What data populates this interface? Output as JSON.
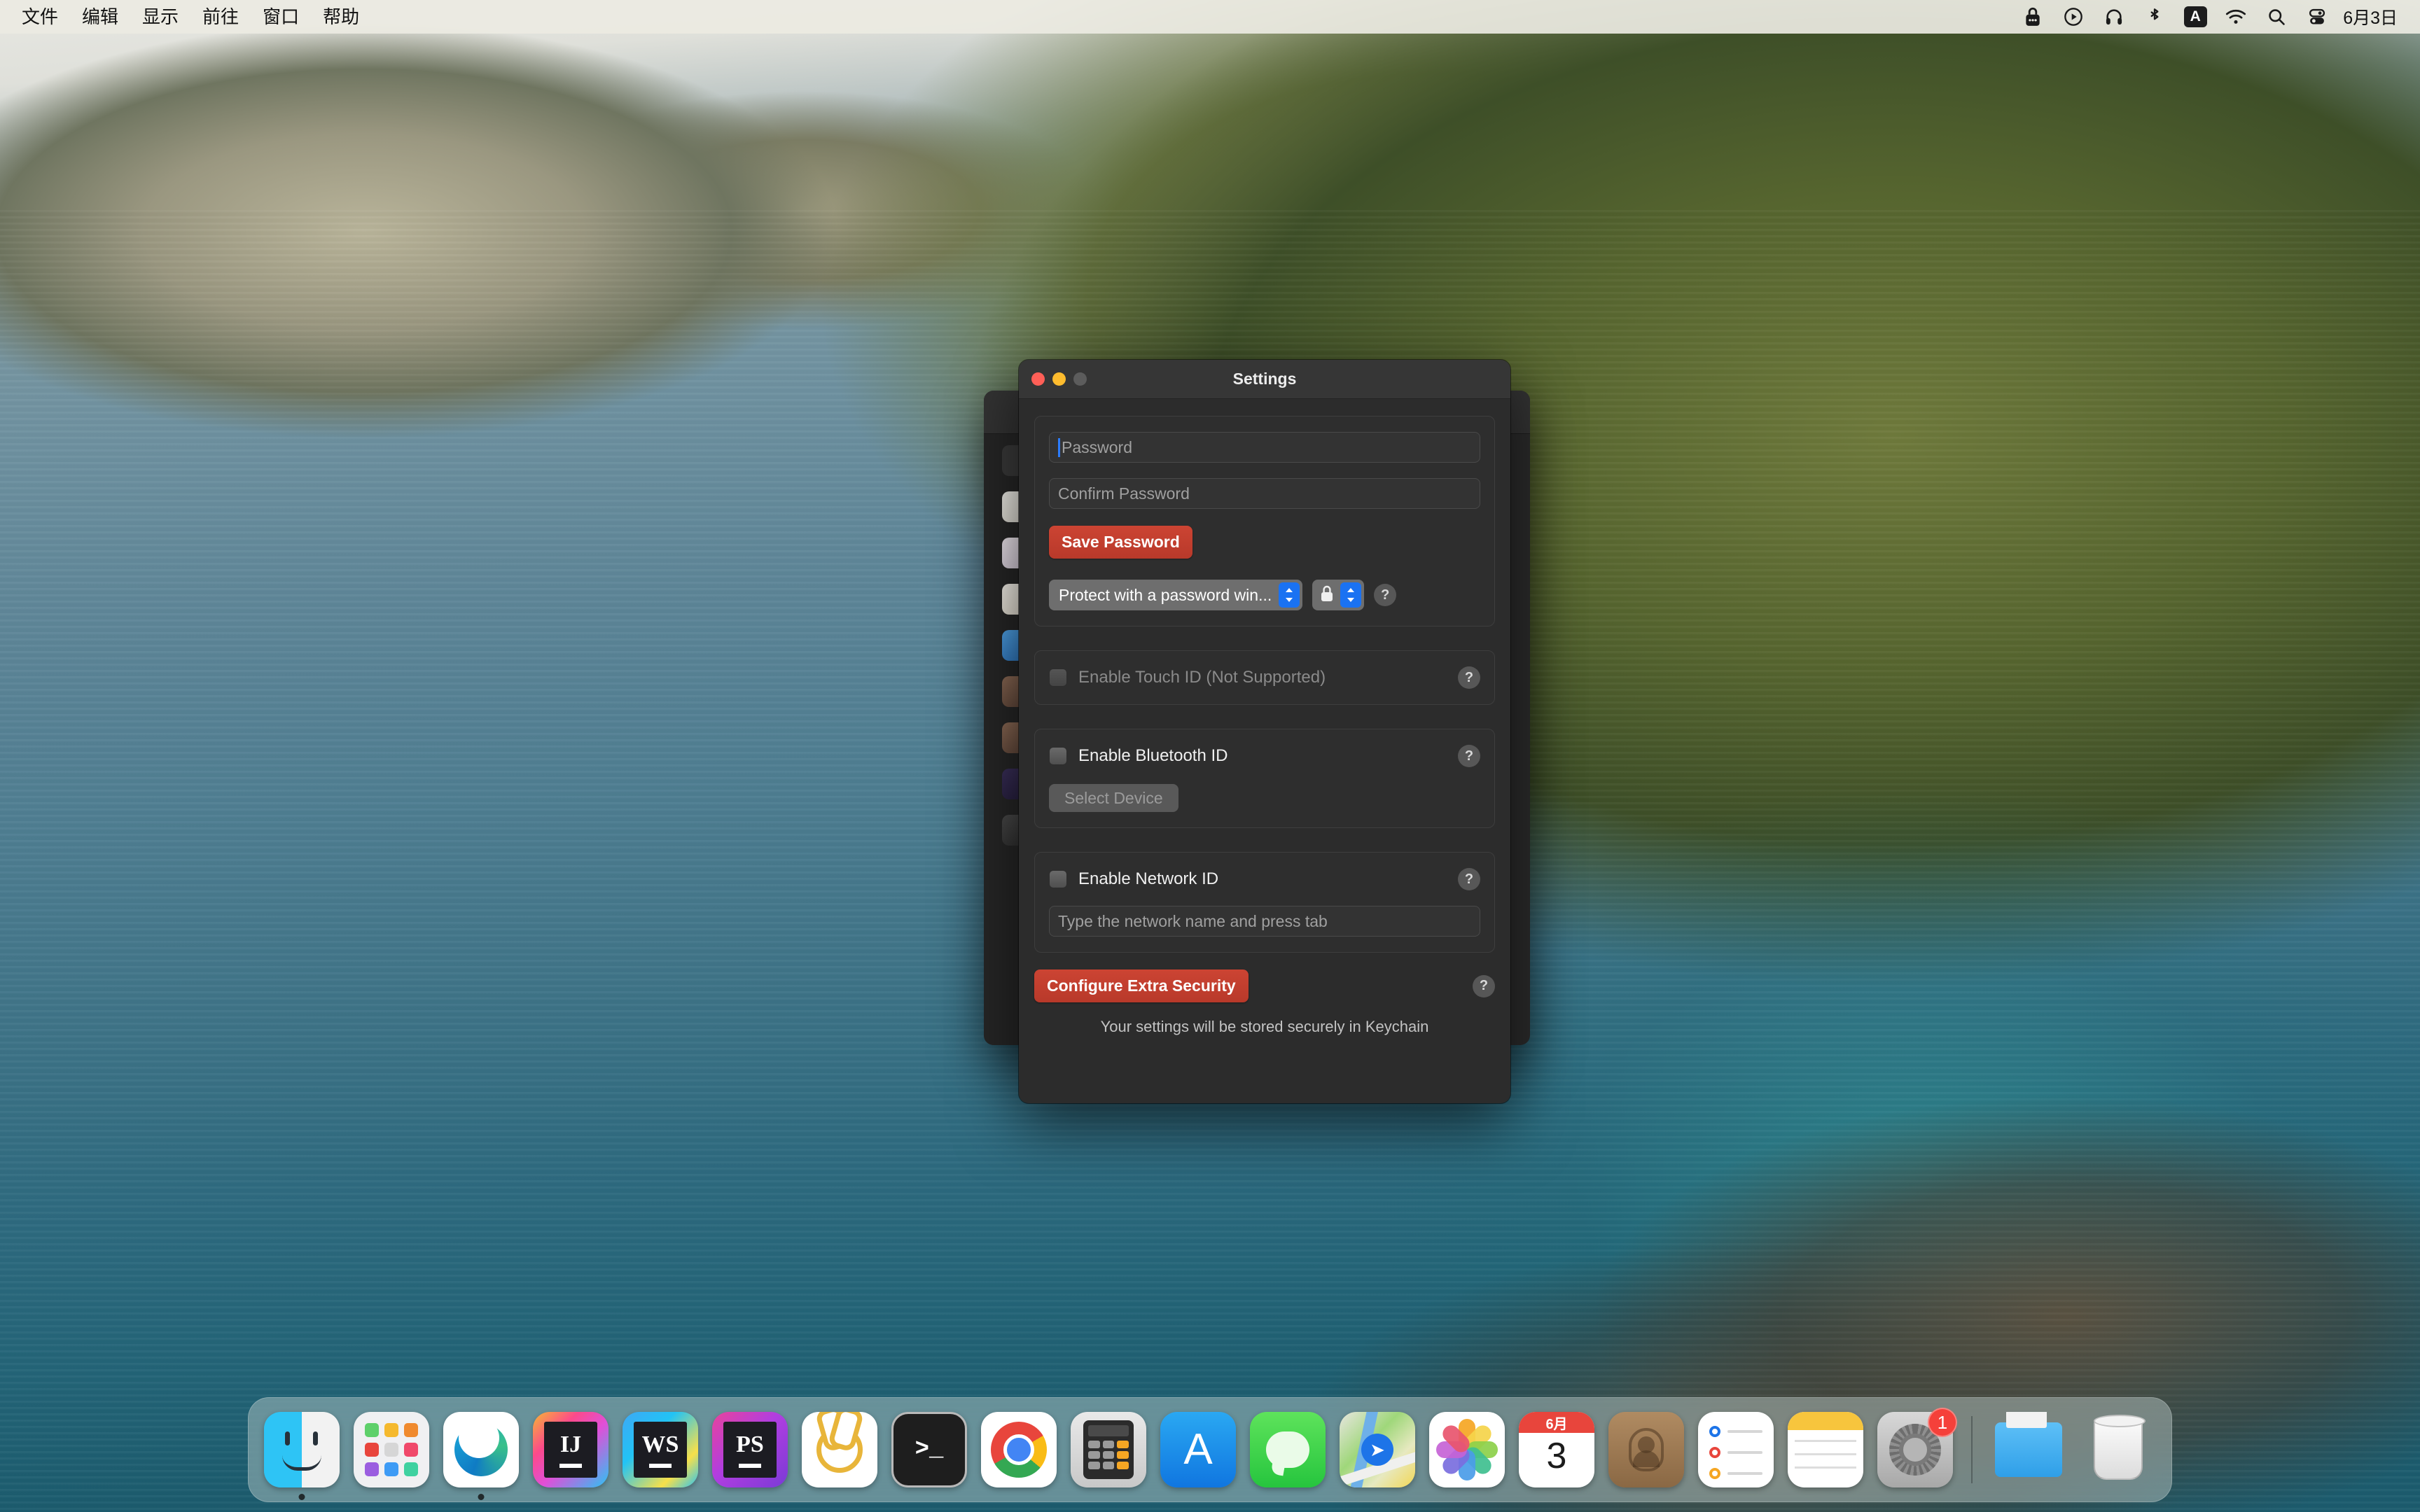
{
  "menubar": {
    "items": [
      {
        "label": "文件",
        "name": "menu-file"
      },
      {
        "label": "编辑",
        "name": "menu-edit"
      },
      {
        "label": "显示",
        "name": "menu-view"
      },
      {
        "label": "前往",
        "name": "menu-go"
      },
      {
        "label": "窗口",
        "name": "menu-window"
      },
      {
        "label": "帮助",
        "name": "menu-help"
      }
    ],
    "status_icons": [
      {
        "name": "lock-icon",
        "glyph": "🔒"
      },
      {
        "name": "media-play-icon",
        "glyph": "▶"
      },
      {
        "name": "headphones-icon",
        "glyph": "🎧"
      },
      {
        "name": "bluetooth-icon",
        "glyph": "✻"
      },
      {
        "name": "input-source-icon",
        "glyph": "A"
      },
      {
        "name": "wifi-icon",
        "glyph": "wifi"
      },
      {
        "name": "spotlight-search-icon",
        "glyph": "search"
      },
      {
        "name": "control-center-icon",
        "glyph": "toggles"
      }
    ],
    "clock": "6月3日"
  },
  "dialog": {
    "title": "Settings",
    "window_controls": {
      "close": "close",
      "minimize": "minimize",
      "zoom": "zoom"
    },
    "password_group": {
      "password_placeholder": "Password",
      "password_value": "",
      "confirm_placeholder": "Confirm Password",
      "confirm_value": "",
      "save_button": "Save Password",
      "protect_popup_selected": "Protect with a password win...",
      "lock_popup_icon": "lock-icon",
      "help": "?"
    },
    "touch_id": {
      "label": "Enable Touch ID (Not Supported)",
      "checked": false,
      "disabled": true,
      "help": "?"
    },
    "bluetooth_id": {
      "label": "Enable Bluetooth ID",
      "checked": false,
      "select_device_button": "Select Device",
      "select_device_disabled": true,
      "help": "?"
    },
    "network_id": {
      "label": "Enable Network ID",
      "checked": false,
      "network_placeholder": "Type the network name and press tab",
      "network_value": "",
      "help": "?"
    },
    "extra_security": {
      "button": "Configure Extra Security",
      "help": "?"
    },
    "footnote": "Your settings will be stored securely in Keychain"
  },
  "background_window": {
    "sidebar_icon_count": 9,
    "row_chevron": "›",
    "row_count": 8
  },
  "dock": {
    "items": [
      {
        "name": "dock-item-finder",
        "label": "Finder",
        "running": true
      },
      {
        "name": "dock-item-launchpad",
        "label": "Launchpad",
        "running": false
      },
      {
        "name": "dock-item-microsoft-edge",
        "label": "Microsoft Edge",
        "running": true
      },
      {
        "name": "dock-item-intellij-idea",
        "label": "IntelliJ IDEA",
        "running": false,
        "badge_text": "IJ"
      },
      {
        "name": "dock-item-webstorm",
        "label": "WebStorm",
        "running": false,
        "badge_text": "WS"
      },
      {
        "name": "dock-item-phpstorm",
        "label": "PhpStorm",
        "running": false,
        "badge_text": "PS"
      },
      {
        "name": "dock-item-navicat",
        "label": "Navicat",
        "running": false
      },
      {
        "name": "dock-item-terminal",
        "label": "Terminal",
        "running": false
      },
      {
        "name": "dock-item-google-chrome",
        "label": "Google Chrome",
        "running": false
      },
      {
        "name": "dock-item-calculator",
        "label": "Calculator",
        "running": false
      },
      {
        "name": "dock-item-app-store",
        "label": "App Store",
        "running": false
      },
      {
        "name": "dock-item-messages",
        "label": "Messages",
        "running": false
      },
      {
        "name": "dock-item-maps",
        "label": "Maps",
        "running": false
      },
      {
        "name": "dock-item-photos",
        "label": "Photos",
        "running": false
      },
      {
        "name": "dock-item-calendar",
        "label": "Calendar",
        "running": false,
        "month": "6月",
        "day": "3"
      },
      {
        "name": "dock-item-contacts",
        "label": "Contacts",
        "running": false
      },
      {
        "name": "dock-item-reminders",
        "label": "Reminders",
        "running": false
      },
      {
        "name": "dock-item-notes",
        "label": "Notes",
        "running": false
      },
      {
        "name": "dock-item-system-settings",
        "label": "System Settings",
        "running": false,
        "badge": "1"
      },
      {
        "name": "dock-item-downloads-folder",
        "label": "Downloads",
        "running": false
      },
      {
        "name": "dock-item-trash",
        "label": "Trash",
        "running": false
      }
    ]
  },
  "colors": {
    "accent_red": "#b8392a",
    "accent_blue": "#1a72f2",
    "dialog_bg": "#2c2c2c",
    "titlebar_bg": "#363636",
    "field_bg": "#333333",
    "badge_red": "#f5403a"
  }
}
